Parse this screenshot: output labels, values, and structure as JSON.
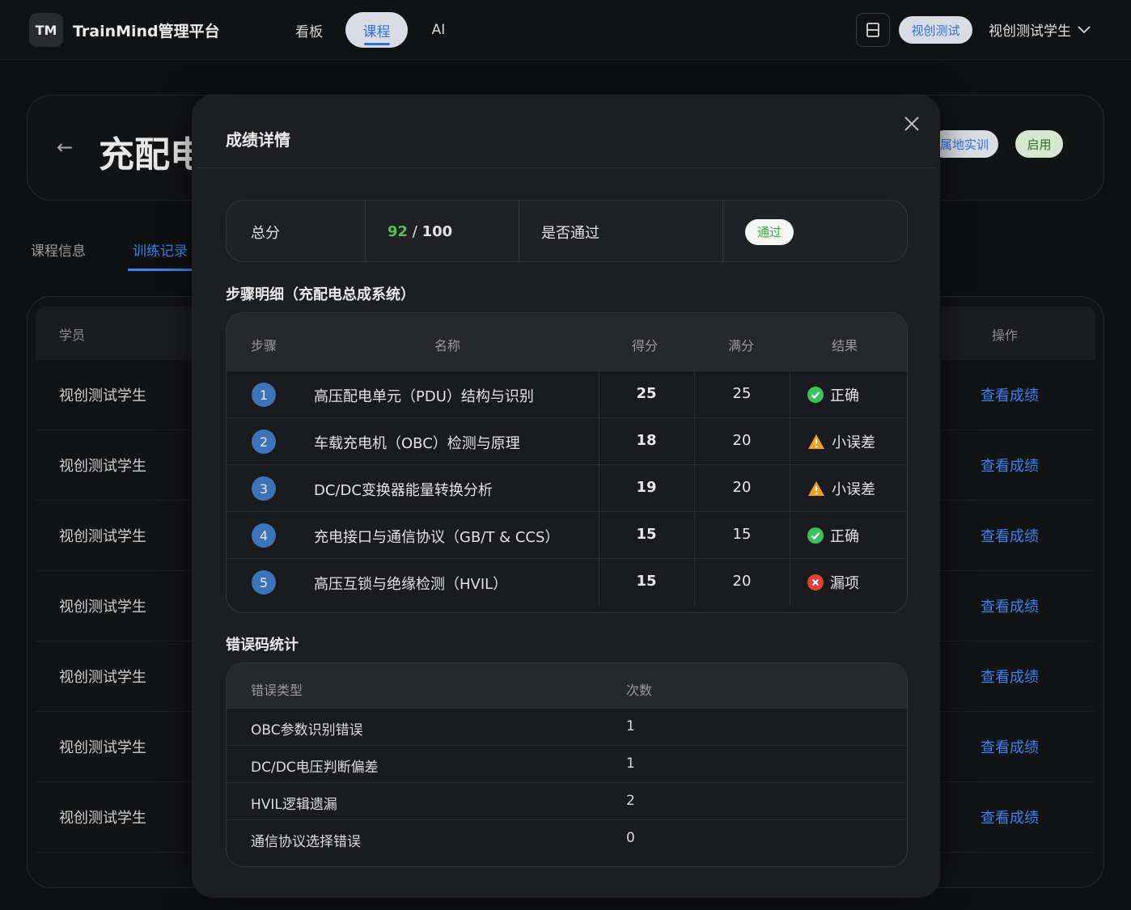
{
  "header": {
    "logo": "TM",
    "brand": "TrainMind管理平台",
    "nav": [
      {
        "label": "看板",
        "active": false
      },
      {
        "label": "课程",
        "active": true
      },
      {
        "label": "AI",
        "active": false
      }
    ],
    "org_badge": "视创测试",
    "user_name": "视创测试学生"
  },
  "background": {
    "course_title": "充配电",
    "tag_site": "属地实训",
    "tag_status": "启用",
    "tabs": [
      "课程信息",
      "训练记录"
    ],
    "table_head": {
      "student": "学员",
      "action": "操作"
    },
    "rows": [
      {
        "student": "视创测试学生",
        "action": "查看成绩"
      },
      {
        "student": "视创测试学生",
        "action": "查看成绩"
      },
      {
        "student": "视创测试学生",
        "action": "查看成绩"
      },
      {
        "student": "视创测试学生",
        "action": "查看成绩"
      },
      {
        "student": "视创测试学生",
        "action": "查看成绩"
      },
      {
        "student": "视创测试学生",
        "action": "查看成绩"
      },
      {
        "student": "视创测试学生",
        "action": "查看成绩"
      }
    ]
  },
  "modal": {
    "title": "成绩详情",
    "summary": {
      "total_label": "总分",
      "score": "92",
      "score_sep": " / ",
      "score_max": "100",
      "pass_label": "是否通过",
      "pass_value": "通过"
    },
    "steps_title": "步骤明细（充配电总成系统）",
    "steps_head": {
      "step": "步骤",
      "name": "名称",
      "score": "得分",
      "full": "满分",
      "result": "结果"
    },
    "steps": [
      {
        "num": "1",
        "name": "高压配电单元（PDU）结构与识别",
        "score": "25",
        "full": "25",
        "result": "正确",
        "status": "ok"
      },
      {
        "num": "2",
        "name": "车载充电机（OBC）检测与原理",
        "score": "18",
        "full": "20",
        "result": "小误差",
        "status": "warn"
      },
      {
        "num": "3",
        "name": "DC/DC变换器能量转换分析",
        "score": "19",
        "full": "20",
        "result": "小误差",
        "status": "warn"
      },
      {
        "num": "4",
        "name": "充电接口与通信协议（GB/T & CCS）",
        "score": "15",
        "full": "15",
        "result": "正确",
        "status": "ok"
      },
      {
        "num": "5",
        "name": "高压互锁与绝缘检测（HVIL）",
        "score": "15",
        "full": "20",
        "result": "漏项",
        "status": "miss"
      }
    ],
    "errors_title": "错误码统计",
    "errors_head": {
      "type": "错误类型",
      "count": "次数"
    },
    "errors": [
      {
        "type": "OBC参数识别错误",
        "count": "1"
      },
      {
        "type": "DC/DC电压判断偏差",
        "count": "1"
      },
      {
        "type": "HVIL逻辑遗漏",
        "count": "2"
      },
      {
        "type": "通信协议选择错误",
        "count": "0"
      }
    ],
    "colors": {
      "ok": "#3cc15e",
      "warn": "#f0a020",
      "miss": "#e0403a",
      "accent": "#2d6fe0"
    }
  }
}
